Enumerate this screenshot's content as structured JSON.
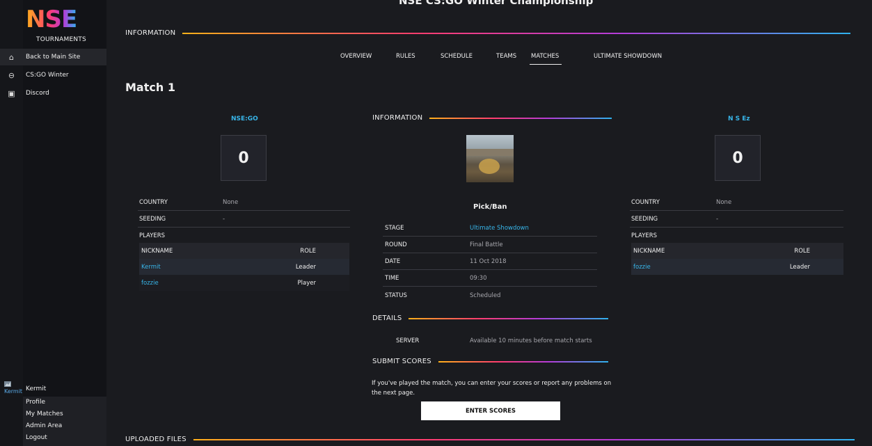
{
  "sidebar": {
    "logo_text": "NSE",
    "subtitle": "TOURNAMENTS",
    "items": [
      {
        "label": "Back to Main Site",
        "icon": "home-icon"
      },
      {
        "label": "CS:GO Winter",
        "icon": "controller-icon"
      },
      {
        "label": "Discord",
        "icon": "chat-icon"
      }
    ],
    "user": {
      "avatar_alt": "Kermit",
      "name": "Kermit",
      "links": [
        "Profile",
        "My Matches",
        "Admin Area",
        "Logout"
      ]
    }
  },
  "header": {
    "title": "NSE CS:GO Winter Championship",
    "section": "INFORMATION"
  },
  "tabs": [
    "OVERVIEW",
    "RULES",
    "SCHEDULE",
    "TEAMS",
    "MATCHES",
    "ULTIMATE SHOWDOWN"
  ],
  "active_tab": "MATCHES",
  "match": {
    "title": "Match 1",
    "team1": {
      "name": "NSE:GO",
      "score": "0",
      "country_label": "COUNTRY",
      "country": "None",
      "seeding_label": "SEEDING",
      "seeding": "-",
      "players_label": "PLAYERS",
      "col_nickname": "NICKNAME",
      "col_role": "ROLE",
      "players": [
        {
          "nickname": "Kermit",
          "role": "Leader"
        },
        {
          "nickname": "fozzie",
          "role": "Player"
        }
      ]
    },
    "team2": {
      "name": "N S Ez",
      "score": "0",
      "country_label": "COUNTRY",
      "country": "None",
      "seeding_label": "SEEDING",
      "seeding": "-",
      "players_label": "PLAYERS",
      "col_nickname": "NICKNAME",
      "col_role": "ROLE",
      "players": [
        {
          "nickname": "fozzie",
          "role": "Leader"
        }
      ]
    },
    "info": {
      "heading": "INFORMATION",
      "map_label": "Pick/Ban",
      "rows": [
        {
          "label": "STAGE",
          "value": "Ultimate Showdown"
        },
        {
          "label": "ROUND",
          "value": "Final Battle"
        },
        {
          "label": "DATE",
          "value": "11 Oct 2018"
        },
        {
          "label": "TIME",
          "value": "09:30"
        },
        {
          "label": "STATUS",
          "value": "Scheduled"
        }
      ]
    },
    "details": {
      "heading": "DETAILS",
      "server_label": "SERVER",
      "server_value": "Available 10 minutes before match starts"
    },
    "submit": {
      "heading": "SUBMIT SCORES",
      "text": "If you've played the match, you can enter your scores or report any problems on the next page.",
      "button": "ENTER SCORES"
    }
  },
  "uploaded_files": {
    "heading": "UPLOADED FILES"
  }
}
